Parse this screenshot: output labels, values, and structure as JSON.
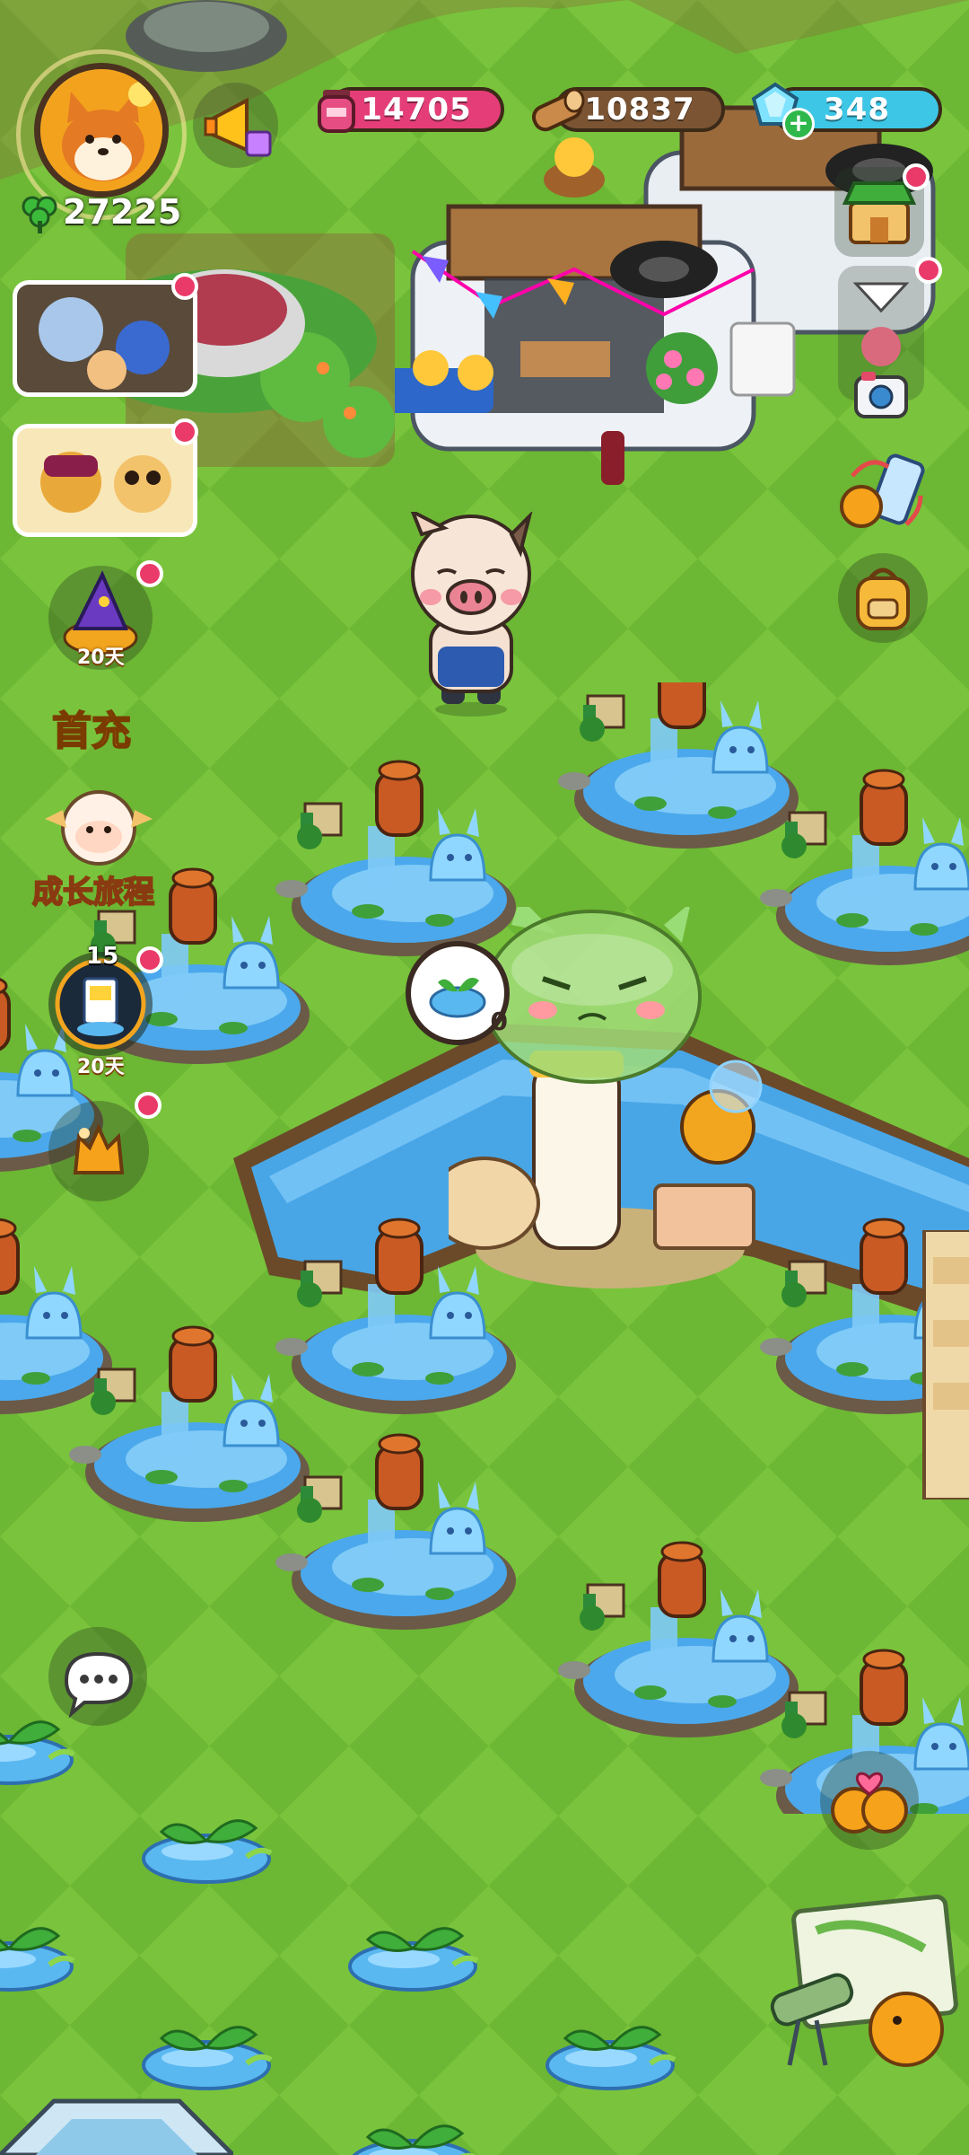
{
  "hud": {
    "coins": "27225",
    "potion": "14705",
    "wood": "10837",
    "gems": "348"
  },
  "side": {
    "event_days_1": "20天",
    "recharge_label": "首充",
    "growth_label": "成长旅程",
    "level_count": "15",
    "event_days_2": "20天"
  },
  "bubble": {
    "count": "0"
  },
  "colors": {
    "grass_light": "#7cc63f",
    "grass_dark": "#65b030",
    "water": "#5ab8f0",
    "potion_pill": "#e43d78",
    "gem_pill": "#3dc6e6",
    "wood_pill": "#7b5433",
    "badge": "#ea3a6a"
  }
}
